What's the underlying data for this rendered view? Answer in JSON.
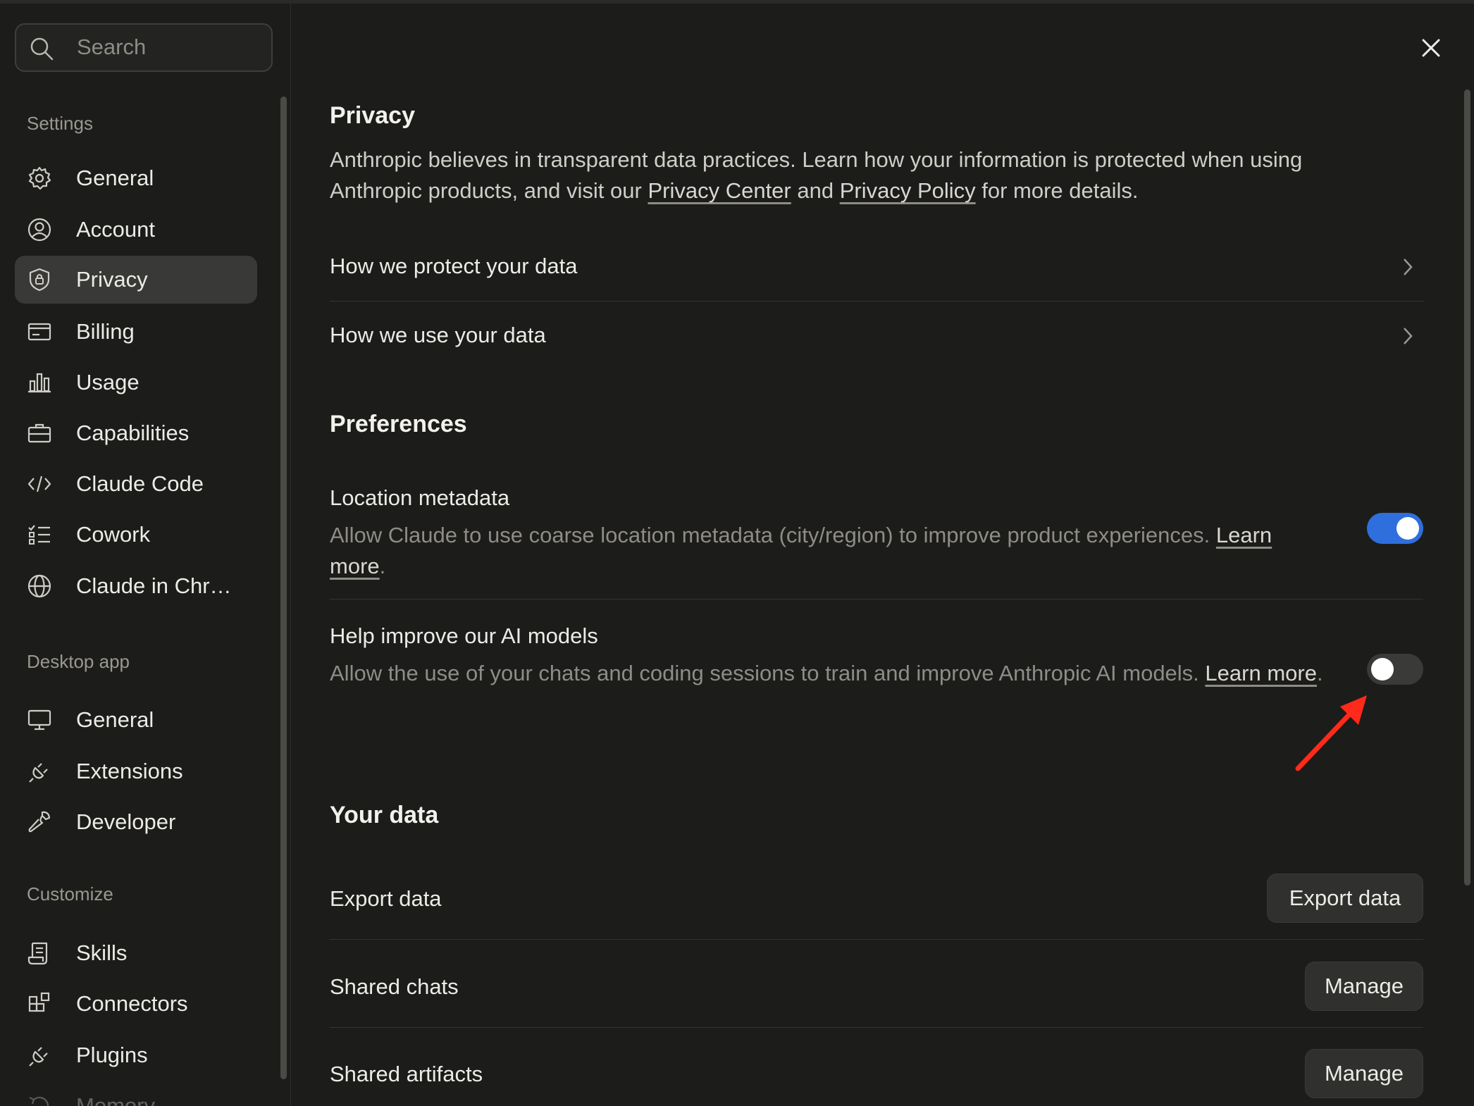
{
  "search": {
    "placeholder": "Search"
  },
  "sidebar": {
    "settings_label": "Settings",
    "settings_items": [
      {
        "label": "General",
        "icon": "gear-icon"
      },
      {
        "label": "Account",
        "icon": "user-circle-icon"
      },
      {
        "label": "Privacy",
        "icon": "shield-lock-icon",
        "active": true
      },
      {
        "label": "Billing",
        "icon": "credit-card-icon"
      },
      {
        "label": "Usage",
        "icon": "bar-chart-icon"
      },
      {
        "label": "Capabilities",
        "icon": "briefcase-icon"
      },
      {
        "label": "Claude Code",
        "icon": "code-icon"
      },
      {
        "label": "Cowork",
        "icon": "list-check-icon"
      },
      {
        "label": "Claude in Chr…",
        "icon": "globe-icon"
      }
    ],
    "desktop_label": "Desktop app",
    "desktop_items": [
      {
        "label": "General",
        "icon": "monitor-icon"
      },
      {
        "label": "Extensions",
        "icon": "plug-icon"
      },
      {
        "label": "Developer",
        "icon": "wrench-icon"
      }
    ],
    "customize_label": "Customize",
    "customize_items": [
      {
        "label": "Skills",
        "icon": "scroll-icon"
      },
      {
        "label": "Connectors",
        "icon": "blocks-icon"
      },
      {
        "label": "Plugins",
        "icon": "plug-icon"
      },
      {
        "label": "Memory",
        "icon": "history-icon"
      }
    ]
  },
  "main": {
    "privacy_heading": "Privacy",
    "intro": {
      "part1": "Anthropic believes in transparent data practices. Learn how your information is protected when using Anthropic products, and visit our ",
      "link1": "Privacy Center",
      "part2": " and ",
      "link2": "Privacy Policy",
      "part3": " for more details."
    },
    "links": [
      {
        "label": "How we protect your data"
      },
      {
        "label": "How we use your data"
      }
    ],
    "preferences_heading": "Preferences",
    "preferences": [
      {
        "title": "Location metadata",
        "desc": "Allow Claude to use coarse location metadata (city/region) to improve product experiences. ",
        "link": "Learn more",
        "after": ".",
        "enabled": true
      },
      {
        "title": "Help improve our AI models",
        "desc": "Allow the use of your chats and coding sessions to train and improve Anthropic AI models. ",
        "link": "Learn more",
        "after": ".",
        "enabled": false
      }
    ],
    "your_data_heading": "Your data",
    "data_rows": [
      {
        "label": "Export data",
        "button": "Export data"
      },
      {
        "label": "Shared chats",
        "button": "Manage"
      },
      {
        "label": "Shared artifacts",
        "button": "Manage"
      }
    ]
  },
  "colors": {
    "accent": "#2f6fdd",
    "annotation_arrow": "#ff2a1a",
    "background": "#1c1c1b"
  }
}
